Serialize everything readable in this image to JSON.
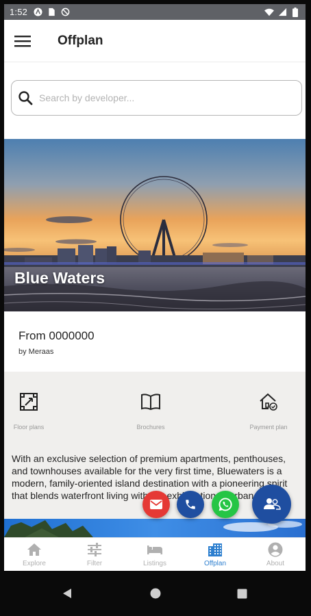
{
  "status_bar": {
    "time": "1:52"
  },
  "app_bar": {
    "title": "Offplan"
  },
  "search": {
    "placeholder": "Search by developer..."
  },
  "project": {
    "name": "Blue Waters",
    "price_label": "From 0000000",
    "developer_label": "by Meraas",
    "resources": [
      {
        "label": "Floor plans",
        "icon": "floor-plan-icon"
      },
      {
        "label": "Brochures",
        "icon": "book-icon"
      },
      {
        "label": "Payment plan",
        "icon": "house-check-icon"
      }
    ],
    "description": "With an exclusive selection of premium apartments, penthouses, and townhouses available for the very first time, Bluewaters is a modern, family-oriented island destination with a pioneering spirit that blends waterfront living with the exhilaration of urban city life."
  },
  "fabs": [
    {
      "name": "email",
      "icon": "email-icon",
      "color": "#e53935"
    },
    {
      "name": "call",
      "icon": "phone-icon",
      "color": "#1f4ea0"
    },
    {
      "name": "whatsapp",
      "icon": "whatsapp-icon",
      "color": "#25c545"
    },
    {
      "name": "contact",
      "icon": "contacts-icon",
      "color": "#1f4ea0"
    }
  ],
  "bottom_nav": {
    "items": [
      {
        "label": "Explore",
        "icon": "home-icon",
        "active": false
      },
      {
        "label": "Filter",
        "icon": "sliders-icon",
        "active": false
      },
      {
        "label": "Listings",
        "icon": "bed-icon",
        "active": false
      },
      {
        "label": "Offplan",
        "icon": "building-icon",
        "active": true
      },
      {
        "label": "About",
        "icon": "account-icon",
        "active": false
      }
    ]
  },
  "colors": {
    "accent": "#2d7fcf",
    "fab_blue": "#1f4ea0",
    "inactive": "#b0b0b0"
  }
}
